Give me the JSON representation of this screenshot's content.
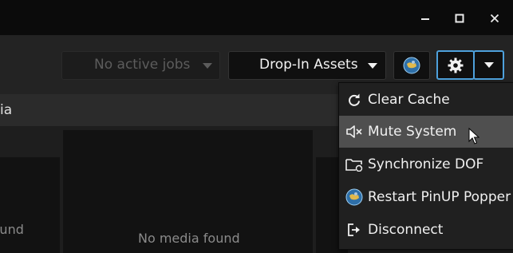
{
  "titlebar": {
    "buttons": {
      "minimize_icon": "minimize-icon",
      "maximize_icon": "maximize-icon",
      "close_icon": "close-icon"
    }
  },
  "toolbar": {
    "jobs_dropdown": {
      "label": "No active jobs",
      "enabled": false
    },
    "assets_dropdown": {
      "label": "Drop-In Assets"
    },
    "popper_button_icon": "pinup-popper-globe-icon",
    "settings_button_icon": "gear-icon",
    "settings_dropdown_icon": "chevron-down-icon"
  },
  "tabs": {
    "visible_fragment": "ia"
  },
  "media": {
    "card_left_text": "found",
    "card_center_text": "No media found"
  },
  "settings_menu": {
    "items": [
      {
        "label": "Clear Cache",
        "icon": "refresh-icon",
        "highlighted": false
      },
      {
        "label": "Mute System",
        "icon": "mute-speaker-icon",
        "highlighted": true
      },
      {
        "label": "Synchronize DOF",
        "icon": "folder-sync-icon",
        "highlighted": false
      },
      {
        "label": "Restart PinUP Popper",
        "icon": "pinup-popper-globe-icon",
        "highlighted": false
      },
      {
        "label": "Disconnect",
        "icon": "logout-icon",
        "highlighted": false
      }
    ]
  },
  "colors": {
    "accent": "#4ea1dc",
    "highlight": "#4f4f4f",
    "background": "#1e1e1e",
    "titlebar": "#0b0b0b"
  }
}
